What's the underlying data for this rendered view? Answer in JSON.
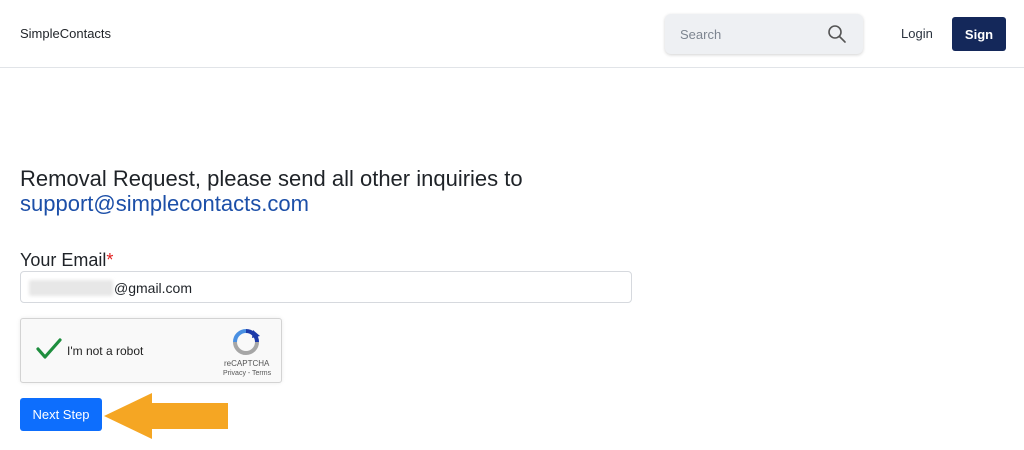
{
  "header": {
    "brand": "SimpleContacts",
    "search": {
      "placeholder": "Search",
      "value": ""
    },
    "login_label": "Login",
    "sign_label": "Sign"
  },
  "main": {
    "heading": "Removal Request, please send all other inquiries to",
    "support_email": "support@simplecontacts.com",
    "email_field": {
      "label": "Your Email",
      "required_mark": "*",
      "value_suffix": "@gmail.com"
    },
    "captcha": {
      "label": "I'm not a robot",
      "brand": "reCAPTCHA",
      "terms": "Privacy - Terms",
      "checked": true
    },
    "next_button_label": "Next Step"
  },
  "colors": {
    "sign_button": "#14285a",
    "next_button": "#0d6efd",
    "link": "#1c4fa8",
    "required": "#e01f1f",
    "arrow": "#f5a623",
    "check": "#1e8e3e"
  },
  "icons": {
    "search": "search-icon",
    "check": "checkmark-icon",
    "recaptcha": "recaptcha-logo-icon",
    "arrow": "arrow-left-icon"
  }
}
